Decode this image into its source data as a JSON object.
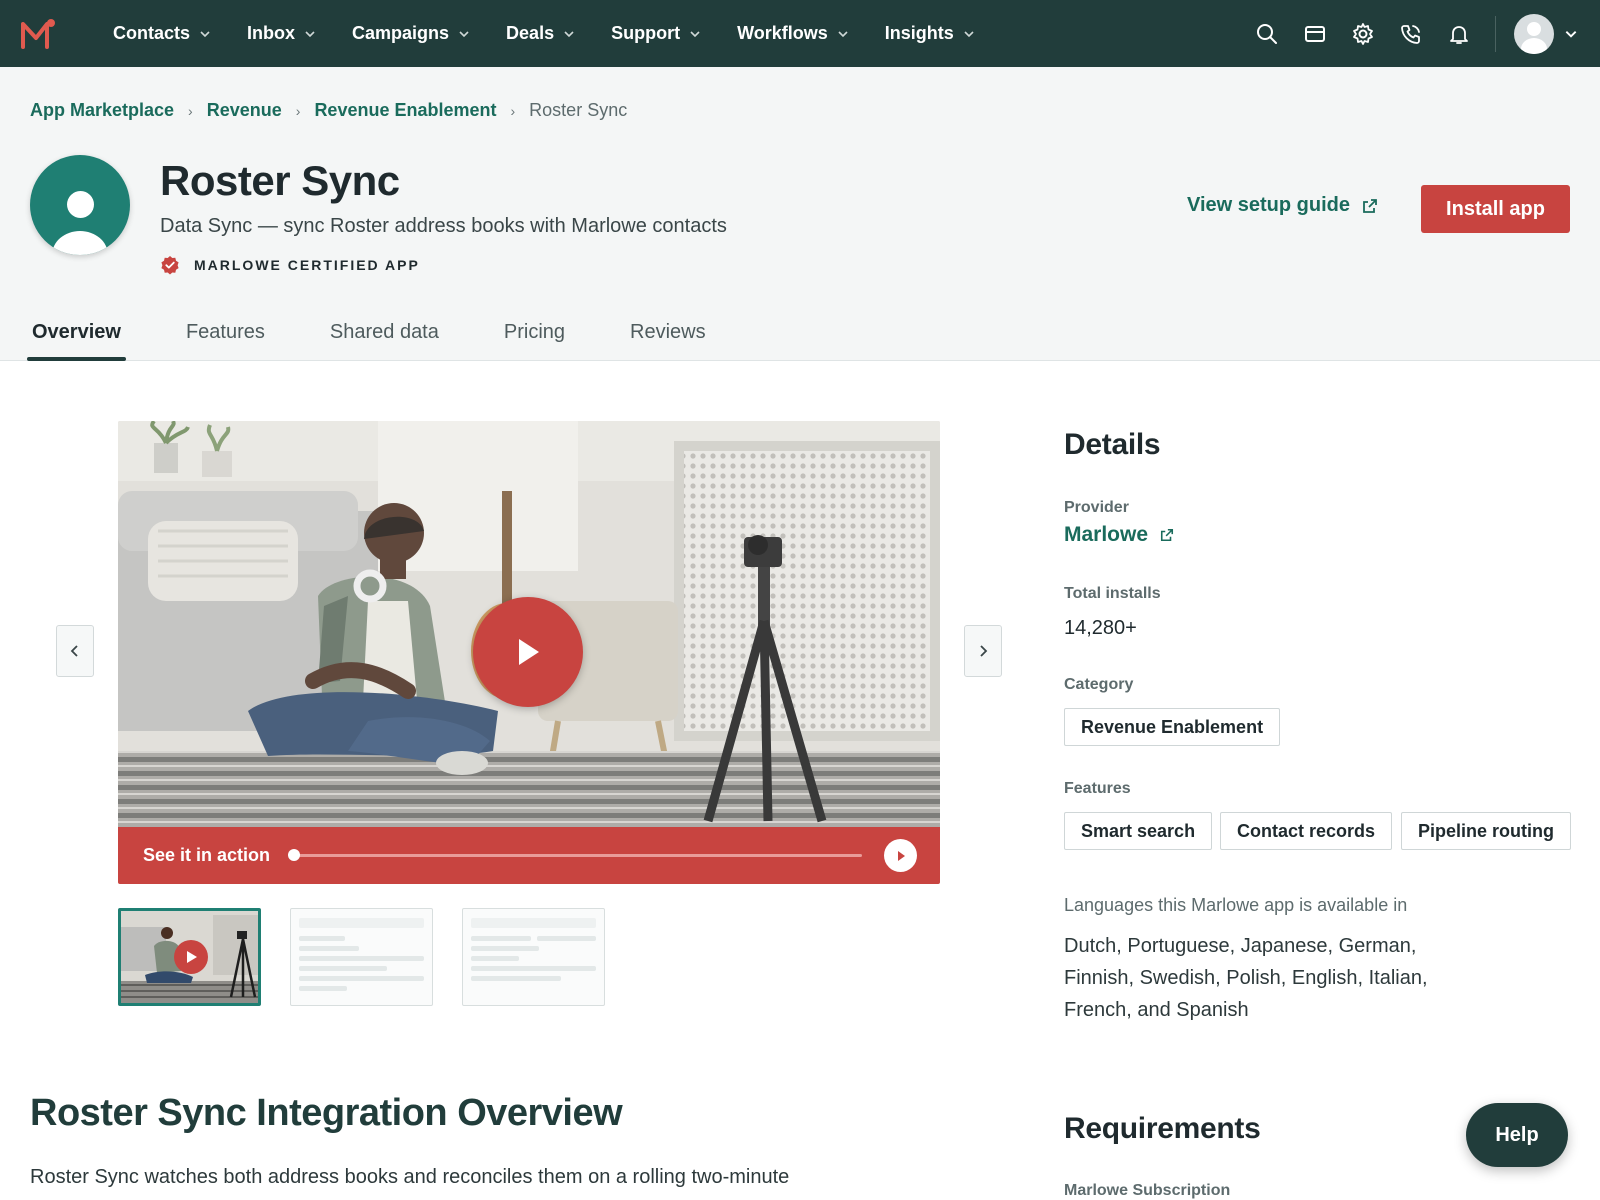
{
  "nav": {
    "logo_icon": "marlowe-logo-icon",
    "items": [
      {
        "label": "Contacts"
      },
      {
        "label": "Inbox"
      },
      {
        "label": "Campaigns"
      },
      {
        "label": "Deals"
      },
      {
        "label": "Support"
      },
      {
        "label": "Workflows"
      },
      {
        "label": "Insights"
      }
    ],
    "icons": [
      "search-icon",
      "marketplace-icon",
      "gear-icon",
      "phone-icon",
      "bell-icon"
    ]
  },
  "breadcrumb": {
    "items": [
      "App Marketplace",
      "Revenue",
      "Revenue Enablement"
    ],
    "current": "Roster Sync"
  },
  "app": {
    "title": "Roster Sync",
    "subtitle": "Data Sync — sync Roster address books with Marlowe contacts",
    "certified_label": "MARLOWE CERTIFIED APP",
    "setup_guide_label": "View setup guide",
    "install_label": "Install app"
  },
  "tabs": [
    {
      "label": "Overview",
      "active": true
    },
    {
      "label": "Features",
      "active": false
    },
    {
      "label": "Shared data",
      "active": false
    },
    {
      "label": "Pricing",
      "active": false
    },
    {
      "label": "Reviews",
      "active": false
    }
  ],
  "media": {
    "caption": "See it in action",
    "progress": 0.0
  },
  "details": {
    "title": "Details",
    "provider_label": "Provider",
    "provider_value": "Marlowe",
    "installs_label": "Total installs",
    "installs_value": "14,280+",
    "category_label": "Category",
    "category_value": "Revenue Enablement",
    "features_label": "Features",
    "features": [
      "Smart search",
      "Contact records",
      "Pipeline routing"
    ],
    "languages_label": "Languages this Marlowe app is available in",
    "languages_value": "Dutch, Portuguese, Japanese, German, Finnish, Swedish, Polish, English, Italian, French, and Spanish"
  },
  "overview": {
    "title": "Roster Sync Integration Overview",
    "text": "Roster Sync watches both address books and reconciles them on a rolling two-minute"
  },
  "requirements": {
    "title": "Requirements",
    "first_label": "Marlowe Subscription"
  },
  "help_label": "Help",
  "colors": {
    "nav_bg": "#213d3b",
    "accent_red": "#c84440",
    "link_green": "#1a6b5c",
    "app_logo": "#1f7f73"
  }
}
